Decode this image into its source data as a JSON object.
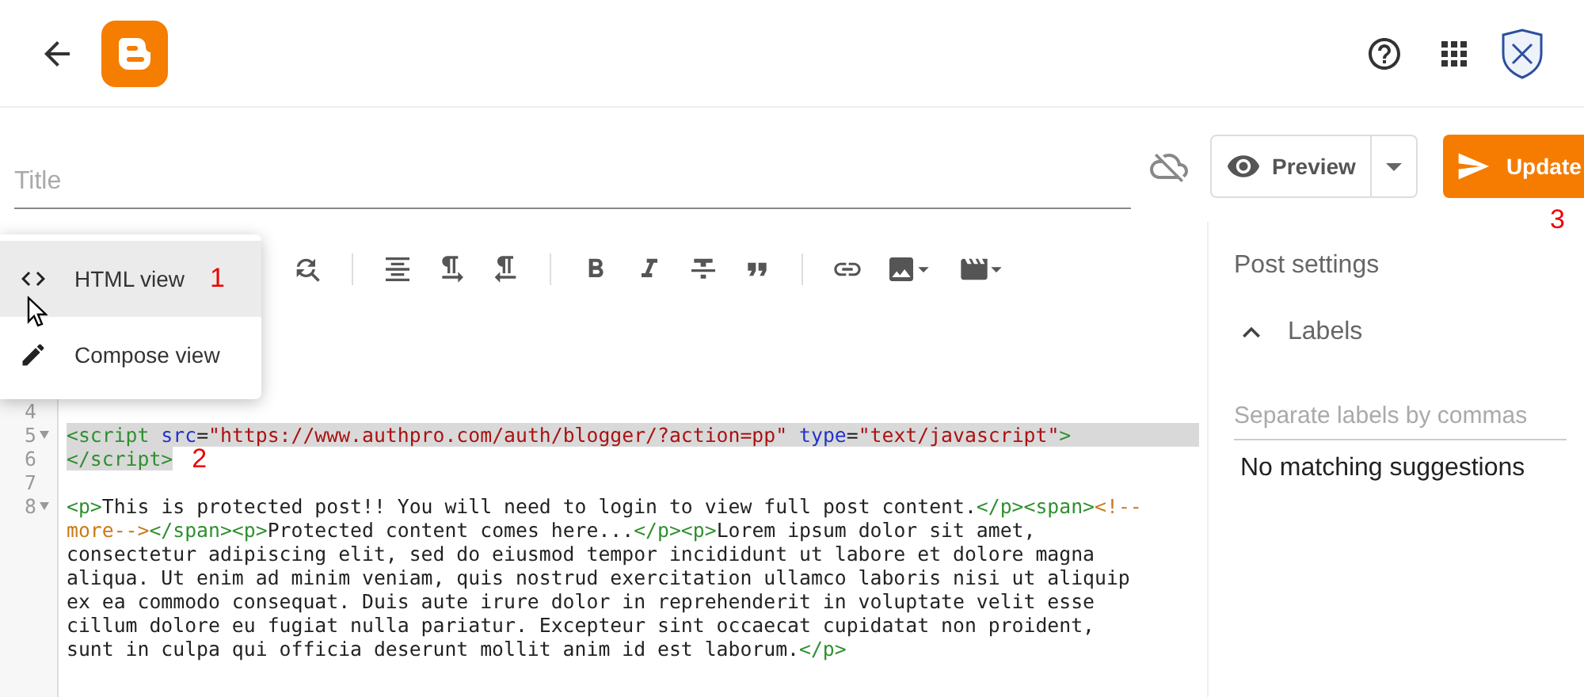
{
  "title_field": {
    "placeholder": "Title"
  },
  "preview_button": {
    "label": "Preview"
  },
  "update_button": {
    "label": "Update",
    "annotation": "3"
  },
  "view_menu": [
    {
      "kind": "html",
      "label": "HTML view",
      "selected": true,
      "annotation": "1"
    },
    {
      "kind": "compose",
      "label": "Compose view",
      "selected": false
    }
  ],
  "code_lines": [
    {
      "number": "4",
      "foldable": false
    },
    {
      "number": "5",
      "foldable": true,
      "highlighted": true,
      "wrapped": [
        {
          "tokens": [
            {
              "kind": "tag",
              "text": "<script"
            },
            {
              "kind": "attr",
              "text": " src"
            },
            {
              "kind": "text",
              "text": "="
            },
            {
              "kind": "string",
              "text": "\"https://www.authpro.com/auth/blogger/?action=pp\""
            },
            {
              "kind": "attr",
              "text": " type"
            },
            {
              "kind": "text",
              "text": "="
            },
            {
              "kind": "string",
              "text": "\"text/javascript\""
            },
            {
              "kind": "tag",
              "text": ">"
            }
          ]
        }
      ]
    },
    {
      "number": "6",
      "foldable": false,
      "highlighted": true,
      "annotation": "2",
      "wrapped": [
        {
          "tokens": [
            {
              "kind": "tag",
              "text": "</script>"
            }
          ]
        }
      ]
    },
    {
      "number": "7",
      "foldable": false
    },
    {
      "number": "8",
      "foldable": true,
      "highlighted": false,
      "wrapped": [
        {
          "tokens": [
            {
              "kind": "tag",
              "text": "<p>"
            },
            {
              "kind": "text",
              "text": "This is protected post!! You will need to login to view full post content."
            },
            {
              "kind": "tag",
              "text": "</p><span>"
            },
            {
              "kind": "comment",
              "text": "<!--"
            }
          ]
        },
        {
          "tokens": [
            {
              "kind": "comment",
              "text": "more-->"
            },
            {
              "kind": "tag",
              "text": "</span><p>"
            },
            {
              "kind": "text",
              "text": "Protected content comes here..."
            },
            {
              "kind": "tag",
              "text": "</p><p>"
            },
            {
              "kind": "text",
              "text": "Lorem ipsum dolor sit amet,"
            }
          ]
        },
        {
          "tokens": [
            {
              "kind": "text",
              "text": "consectetur adipiscing elit, sed do eiusmod tempor incididunt ut labore et dolore magna"
            }
          ]
        },
        {
          "tokens": [
            {
              "kind": "text",
              "text": "aliqua. Ut enim ad minim veniam, quis nostrud exercitation ullamco laboris nisi ut aliquip"
            }
          ]
        },
        {
          "tokens": [
            {
              "kind": "text",
              "text": "ex ea commodo consequat. Duis aute irure dolor in reprehenderit in voluptate velit esse"
            }
          ]
        },
        {
          "tokens": [
            {
              "kind": "text",
              "text": "cillum dolore eu fugiat nulla pariatur. Excepteur sint occaecat cupidatat non proident,"
            }
          ]
        },
        {
          "tokens": [
            {
              "kind": "text",
              "text": "sunt in culpa qui officia deserunt mollit anim id est laborum."
            },
            {
              "kind": "tag",
              "text": "</p>"
            }
          ]
        }
      ]
    }
  ],
  "post_settings": {
    "title": "Post settings",
    "section": {
      "label": "Labels",
      "expanded": true
    },
    "labels_field": {
      "placeholder": "Separate labels by commas"
    },
    "suggestion": "No matching suggestions"
  }
}
